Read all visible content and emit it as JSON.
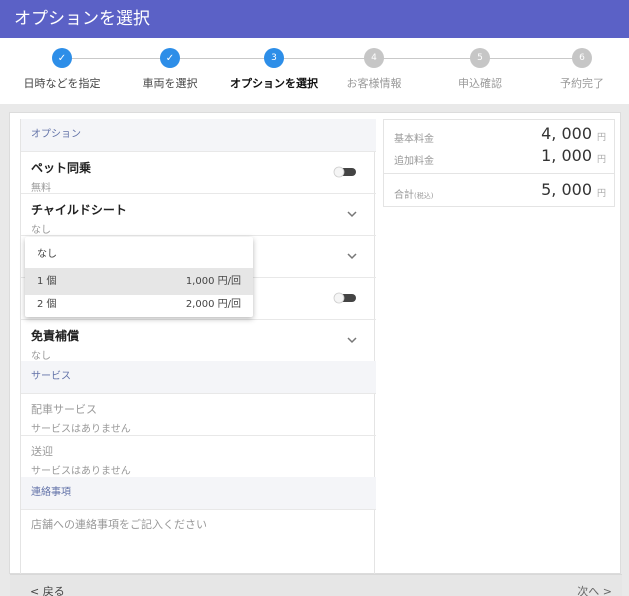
{
  "header": {
    "title": "オプションを選択"
  },
  "stepper": {
    "steps": [
      {
        "label": "日時などを指定",
        "state": "done",
        "mark": "✓"
      },
      {
        "label": "車両を選択",
        "state": "done",
        "mark": "✓"
      },
      {
        "label": "オプションを選択",
        "state": "active",
        "mark": "3"
      },
      {
        "label": "お客様情報",
        "state": "todo",
        "mark": "4"
      },
      {
        "label": "申込確認",
        "state": "todo",
        "mark": "5"
      },
      {
        "label": "予約完了",
        "state": "todo",
        "mark": "6"
      }
    ]
  },
  "options": {
    "section_title": "オプション",
    "items": [
      {
        "name": "ペット同乗",
        "value": "無料",
        "control": "toggle"
      },
      {
        "name": "チャイルドシート",
        "value": "なし",
        "control": "chevron"
      },
      {
        "name": "",
        "value": "",
        "control": "chevron"
      },
      {
        "name": "",
        "value": "",
        "control": "toggle"
      },
      {
        "name": "免責補償",
        "value": "なし",
        "control": "chevron"
      }
    ],
    "dropdown": [
      {
        "label": "なし",
        "price": ""
      },
      {
        "label": "1 個",
        "price": "1,000 円/回"
      },
      {
        "label": "2 個",
        "price": "2,000 円/回"
      }
    ]
  },
  "services": {
    "section_title": "サービス",
    "items": [
      {
        "name": "配車サービス",
        "value": "サービスはありません"
      },
      {
        "name": "送迎",
        "value": "サービスはありません"
      }
    ]
  },
  "contact": {
    "section_title": "連絡事項",
    "placeholder": "店舗への連絡事項をご記入ください"
  },
  "summary": {
    "base_label": "基本料金",
    "base_value": "4, 000",
    "base_unit": "円",
    "extra_label": "追加料金",
    "extra_value": "1, 000",
    "extra_unit": "円",
    "total_label": "合計",
    "total_note": "(税込)",
    "total_value": "5, 000",
    "total_unit": "円"
  },
  "footer": {
    "back_label": "戻る",
    "next_label": "次へ"
  },
  "colors": {
    "accent": "#5b61c6",
    "step_blue": "#2d8ee8"
  }
}
